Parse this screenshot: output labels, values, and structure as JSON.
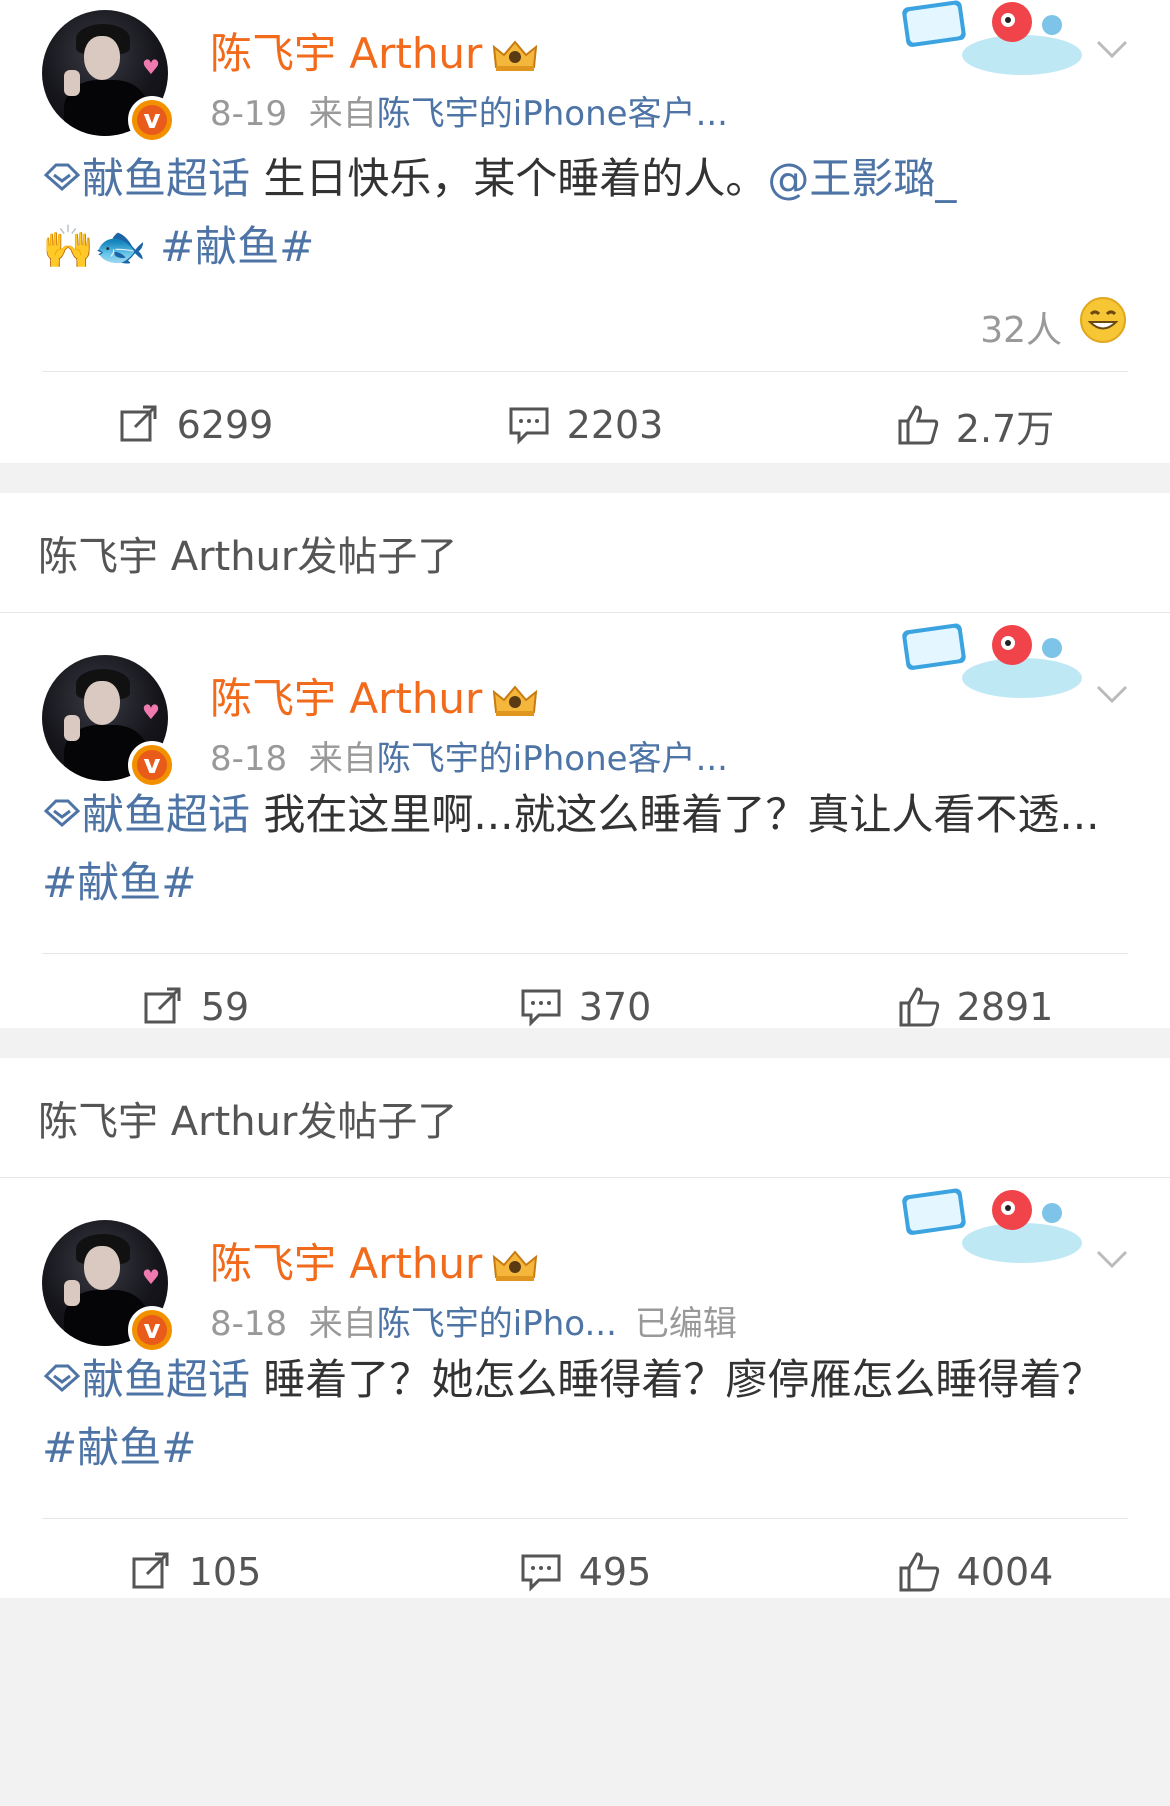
{
  "posts": [
    {
      "author": "陈飞宇 Arthur",
      "date": "8-19",
      "from": "来自",
      "source": "陈飞宇的iPhone客户...",
      "edited": "",
      "topic": "献鱼超话",
      "text": " 生日快乐，某个睡着的人。",
      "mention": "@王影璐_",
      "emoji": "🙌🐟",
      "hashtag": "#献鱼#",
      "reaction_count": "32人",
      "reposts": "6299",
      "comments": "2203",
      "likes": "2.7万"
    },
    {
      "header": "陈飞宇 Arthur发帖子了",
      "author": "陈飞宇 Arthur",
      "date": "8-18",
      "from": "来自",
      "source": "陈飞宇的iPhone客户...",
      "edited": "",
      "topic": "献鱼超话",
      "text": " 我在这里啊...就这么睡着了？真让人看不透... ",
      "hashtag": "#献鱼#",
      "reposts": "59",
      "comments": "370",
      "likes": "2891"
    },
    {
      "header": "陈飞宇 Arthur发帖子了",
      "author": "陈飞宇 Arthur",
      "date": "8-18",
      "from": "来自",
      "source": "陈飞宇的iPho...",
      "edited": "已编辑",
      "topic": "献鱼超话",
      "text": " 睡着了？她怎么睡得着？廖停雁怎么睡得着？  ",
      "hashtag": "#献鱼#",
      "reposts": "105",
      "comments": "495",
      "likes": "4004"
    }
  ],
  "colors": {
    "name": "#f26a1b",
    "link": "#4e74a6",
    "meta": "#999999"
  },
  "icons": {
    "vip": "crown-icon",
    "verified": "v-badge-icon",
    "repost": "repost-icon",
    "comment": "comment-icon",
    "like": "thumbs-up-icon",
    "more": "chevron-down-icon",
    "reaction": "grin-emoji-icon",
    "topic": "super-topic-icon"
  }
}
